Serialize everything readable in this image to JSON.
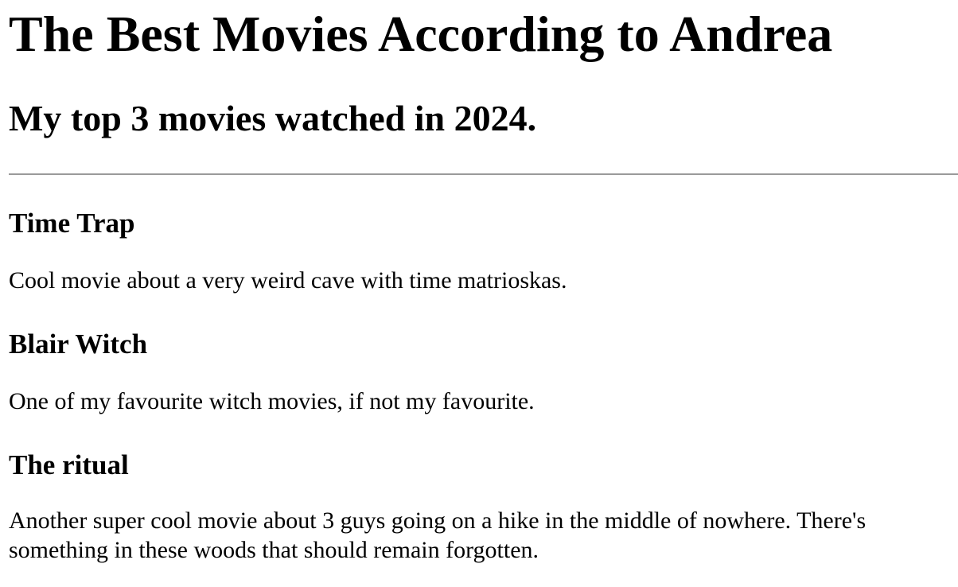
{
  "header": {
    "title": "The Best Movies According to Andrea",
    "subtitle": "My top 3 movies watched in 2024."
  },
  "movies": [
    {
      "title": "Time Trap",
      "description": "Cool movie about a very weird cave with time matrioskas."
    },
    {
      "title": "Blair Witch",
      "description": "One of my favourite witch movies, if not my favourite."
    },
    {
      "title": "The ritual",
      "description": "Another super cool movie about 3 guys going on a hike in the middle of nowhere. There's something in these woods that should remain forgotten."
    }
  ]
}
